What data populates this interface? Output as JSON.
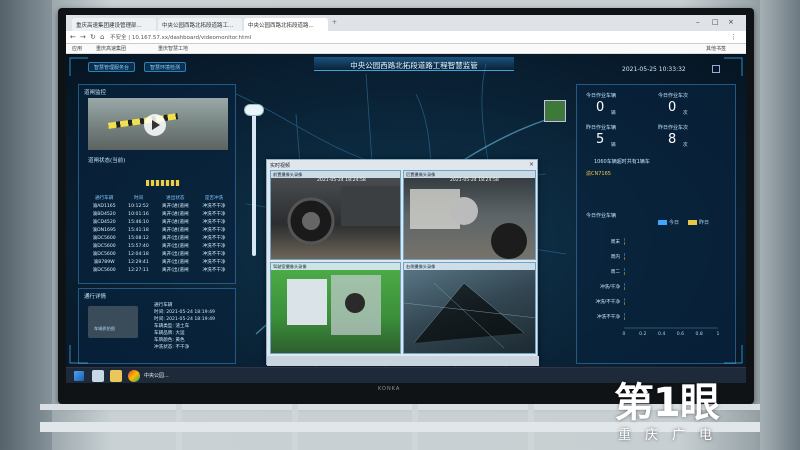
{
  "browser": {
    "tabs": [
      {
        "label": "重庆高速集团建设管理部...",
        "active": false
      },
      {
        "label": "中央公园西路北拓段道路工...",
        "active": false
      },
      {
        "label": "中央公园西路北拓段道路...",
        "active": true
      }
    ],
    "new_tab": "+",
    "url_text": "不安全 | 10.167.57.xx/dashboard/videomonitor.html",
    "bookmarks": [
      "应用",
      "重庆高速集团",
      "重庆智慧工地"
    ],
    "menu_text": "其他书签"
  },
  "dashboard": {
    "tabs": [
      "智慧管理服务台",
      "智慧环境检测"
    ],
    "title": "中央公园西路北拓段道路工程智慧监管",
    "datetime": "2021-05-25 10:33:32",
    "left": {
      "section1": "道闸监控",
      "gate_label": "道闸状态(当前)",
      "table_headers": [
        "通行车辆",
        "时间",
        "进出状态",
        "是否冲洗"
      ],
      "table_rows": [
        [
          "渝AD1165",
          "10:12:52",
          "离开(进)道闸",
          "冲洗不干净"
        ],
        [
          "渝BD4520",
          "10:01:16",
          "离开(进)道闸",
          "冲洗不干净"
        ],
        [
          "渝CD4520",
          "15:46:10",
          "离开(进)道闸",
          "冲洗不干净"
        ],
        [
          "渝DN1695",
          "15:41:18",
          "离开(进)道闸",
          "冲洗不干净"
        ],
        [
          "渝DC5600",
          "15:08:12",
          "离开(出)道闸",
          "冲洗不干净"
        ],
        [
          "渝DC5600",
          "15:57:40",
          "离开(出)道闸",
          "冲洗不干净"
        ],
        [
          "渝DC5600",
          "12:04:18",
          "离开(出)道闸",
          "冲洗不干净"
        ],
        [
          "渝B789W",
          "12:29:41",
          "离开(出)道闸",
          "冲洗不干净"
        ],
        [
          "渝DC5600",
          "12:27:11",
          "离开(出)道闸",
          "冲洗不干净"
        ]
      ],
      "section2": "通行详情",
      "pass_img_label": "车辆抓拍图",
      "pass_info": [
        "通行车辆",
        "时间: 2021-05-24 18:19:49",
        "时间: 2021-05-24 18:19:49",
        "车辆类型: 渣土车",
        "车辆品牌: 大运",
        "车牌颜色: 黄色",
        "冲洗状态: 不干净"
      ]
    },
    "popup": {
      "title": "实时视频",
      "frames": [
        {
          "label": "前置摄像头录像",
          "time": "2021-05-24 18:24:58"
        },
        {
          "label": "后置摄像头录像",
          "time": "2021-05-24 18:24:58"
        },
        {
          "label": "驾驶室摄像头录像",
          "time": ""
        },
        {
          "label": "右侧摄像头录像",
          "time": ""
        }
      ],
      "close": "×"
    },
    "right": {
      "stats": [
        {
          "label": "今日作业车辆",
          "value": "0",
          "unit": "辆"
        },
        {
          "label": "今日作业车次",
          "value": "0",
          "unit": "次"
        },
        {
          "label": "昨日作业车辆",
          "value": "5",
          "unit": "辆"
        },
        {
          "label": "昨日作业车次",
          "value": "8",
          "unit": "次"
        }
      ],
      "ranking_title": "1060车辆超时共有1辆车",
      "ranking_item": "渝CN7165",
      "chart_title": "今日作业车辆",
      "legend": [
        "今日",
        "昨日"
      ]
    },
    "colors": {
      "accent": "#3aa3e0",
      "today": "#3ea6ff",
      "yesterday": "#e8c64a"
    }
  },
  "chart_data": {
    "type": "bar",
    "title": "今日作业车辆",
    "categories": [
      "周末",
      "周内",
      "周二",
      "冲洗/干净",
      "冲洗/不干净",
      "冲洗不干净"
    ],
    "series": [
      {
        "name": "今日",
        "values": [
          0,
          0,
          0,
          0,
          0,
          0
        ]
      },
      {
        "name": "昨日",
        "values": [
          0,
          0,
          0,
          0,
          0,
          0
        ]
      }
    ],
    "x_ticks": [
      "0",
      "0.2",
      "0.4",
      "0.6",
      "0.8",
      "1"
    ],
    "xlim": [
      0,
      1
    ],
    "legend_position": "top-right"
  },
  "taskbar": {
    "app_label": "中央公园..."
  },
  "monitor": {
    "brand": "KONKA"
  },
  "watermark": {
    "main": "第1眼",
    "sub": "重庆广电"
  }
}
